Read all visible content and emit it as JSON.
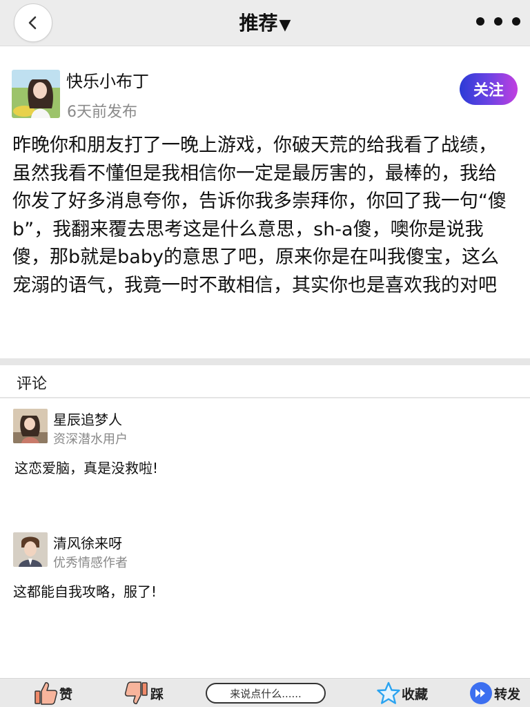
{
  "header": {
    "title": "推荐",
    "title_arrow": "▼"
  },
  "post": {
    "author": {
      "name": "快乐小布丁",
      "time": "6天前发布"
    },
    "follow_label": "关注",
    "text": "昨晚你和朋友打了一晚上游戏，你破天荒的给我看了战绩，虽然我看不懂但是我相信你一定是最厉害的，最棒的，我给你发了好多消息夸你，告诉你我多崇拜你，你回了我一句“傻b”，我翻来覆去思考这是什么意思，sh-a傻，噢你是说我傻，那b就是baby的意思了吧，原来你是在叫我傻宝，这么宠溺的语气，我竟一时不敢相信，其实你也是喜欢我的对吧"
  },
  "comments": {
    "header": "评论",
    "items": [
      {
        "name": "星辰追梦人",
        "role": "资深潜水用户",
        "text": "这恋爱脑，真是没救啦!"
      },
      {
        "name": "清风徐来呀",
        "role": "优秀情感作者",
        "text": "这都能自我攻略，服了!"
      }
    ]
  },
  "bottom_bar": {
    "like_label": "赞",
    "dislike_label": "踩",
    "comment_placeholder": "来说点什么......",
    "favorite_label": "收藏",
    "share_label": "转发"
  },
  "colors": {
    "follow_gradient": [
      "#2b3bd6",
      "#6a43e3",
      "#c13fe0"
    ],
    "like_icon": "#f08a6a",
    "star_icon": "#2aa3f0",
    "share_icon": "#3c6ff0"
  }
}
